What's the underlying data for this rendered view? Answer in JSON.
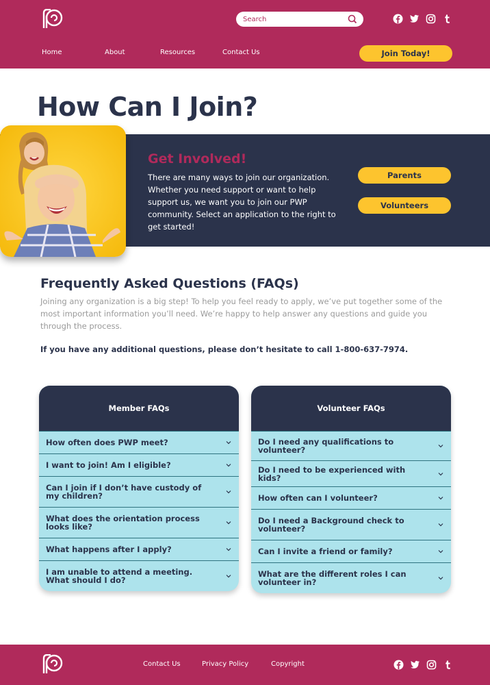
{
  "header": {
    "search_placeholder": "Search",
    "nav": [
      "Home",
      "About",
      "Resources",
      "Contact Us"
    ],
    "join_label": "Join Today!",
    "social_icons": [
      "facebook-icon",
      "twitter-icon",
      "instagram-icon",
      "tumblr-icon"
    ]
  },
  "page_title": "How Can I Join?",
  "involved": {
    "title": "Get Involved!",
    "text": "There are many ways to join our organization. Whether you need support or want to help support us, we want you to join our PWP community. Select an application to the right to get started!",
    "buttons": [
      "Parents",
      "Volunteers"
    ]
  },
  "faq": {
    "title": "Frequently Asked Questions (FAQs)",
    "intro": "Joining any organization is a big step! To help you feel ready to apply, we’ve put together some of the most important information you’ll need. We’re happy to help answer any questions and guide you through the process.",
    "call": "If you have any additional questions, please don’t hesitate to call 1-800-637-7974."
  },
  "member_faqs": {
    "title": "Member FAQs",
    "questions": [
      "How often does PWP meet?",
      "I want to join! Am I eligible?",
      "Can I join if I don’t have custody of my children?",
      "What does the orientation process looks like?",
      "What happens after I apply?",
      "I am unable to attend a meeting. What should I do?"
    ]
  },
  "volunteer_faqs": {
    "title": "Volunteer FAQs",
    "questions": [
      "Do I need any qualifications to volunteer?",
      "Do I need to be experienced with kids?",
      "How often can I volunteer?",
      "Do I need a Background check to volunteer?",
      "Can I invite a friend or family?",
      "What are the different roles I can volunteer in?"
    ]
  },
  "footer": {
    "links": [
      "Contact Us",
      "Privacy Policy",
      "Copyright"
    ]
  },
  "colors": {
    "brand": "#b02a5b",
    "navy": "#2b334b",
    "yellow": "#fdc42e",
    "faq_bg": "#ade3ec"
  }
}
